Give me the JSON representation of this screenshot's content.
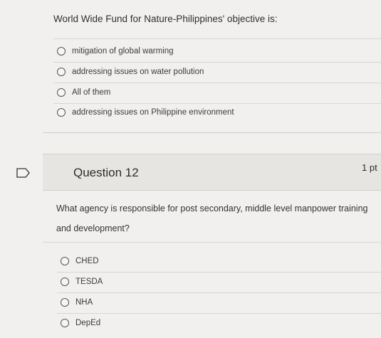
{
  "previous_question": {
    "prompt": "World Wide Fund for Nature-Philippines' objective is:",
    "options": [
      "mitigation of global warming",
      "addressing issues on water pollution",
      "All of them",
      "addressing issues on Philippine environment"
    ]
  },
  "question": {
    "title": "Question 12",
    "points": "1 pt",
    "prompt": "What agency is responsible for post secondary, middle level manpower training and development?",
    "options": [
      "CHED",
      "TESDA",
      "NHA",
      "DepEd"
    ]
  }
}
